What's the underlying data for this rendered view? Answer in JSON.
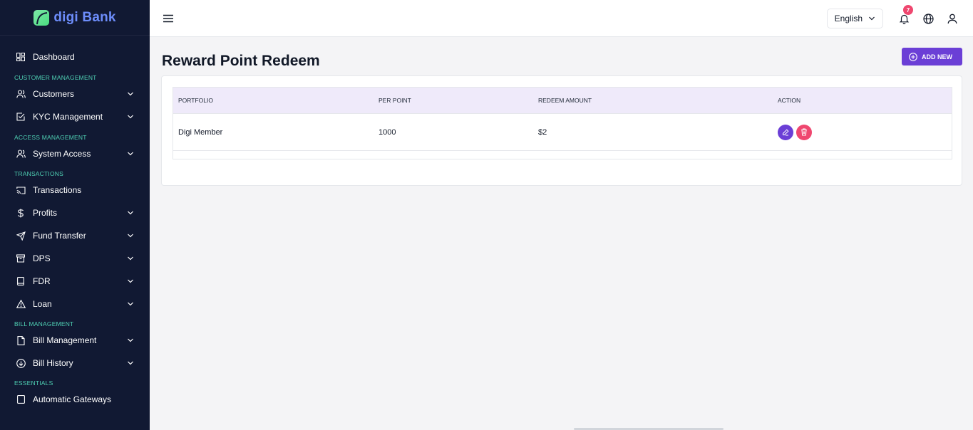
{
  "brand": {
    "name": "digi Bank"
  },
  "sidebar": {
    "dashboard": "Dashboard",
    "sections": {
      "customer_management": "CUSTOMER MANAGEMENT",
      "access_management": "ACCESS MANAGEMENT",
      "transactions": "TRANSACTIONS",
      "bill_management": "BILL MANAGEMENT",
      "essentials": "ESSENTIALS"
    },
    "items": {
      "customers": "Customers",
      "kyc": "KYC Management",
      "system_access": "System Access",
      "transactions": "Transactions",
      "profits": "Profits",
      "fund_transfer": "Fund Transfer",
      "dps": "DPS",
      "fdr": "FDR",
      "loan": "Loan",
      "bill_management": "Bill Management",
      "bill_history": "Bill History",
      "automatic_gateways": "Automatic Gateways"
    }
  },
  "topbar": {
    "language": "English",
    "notification_count": "7"
  },
  "page": {
    "title": "Reward Point Redeem",
    "add_button": "ADD NEW"
  },
  "table": {
    "headers": [
      "PORTFOLIO",
      "PER POINT",
      "REDEEM AMOUNT",
      "ACTION"
    ],
    "rows": [
      {
        "portfolio": "Digi Member",
        "per_point": "1000",
        "redeem_amount": "$2"
      }
    ]
  },
  "colors": {
    "sidebar_bg": "#111933",
    "accent": "#6b3fd6",
    "danger": "#ef476f",
    "section_title": "#4fd1b4",
    "brand_text": "#6d8dfb"
  }
}
